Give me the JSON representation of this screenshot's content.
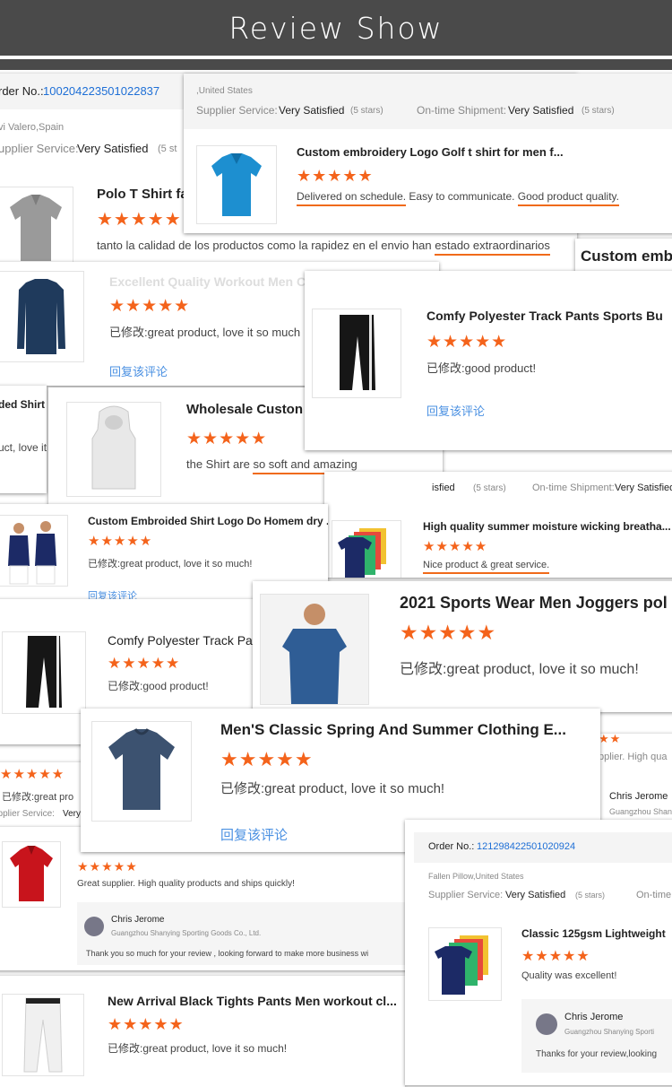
{
  "banner": {
    "title": "Review Show"
  },
  "card1": {
    "order_label": "rder No.:",
    "order_no": "100204223501022837",
    "location": "vi Valero,Spain",
    "supplier_label": "upplier Service:",
    "supplier_value": "Very Satisfied",
    "stars_note": "(5 st",
    "product_title": "Polo T Shirt fa",
    "stars": "★★★★★",
    "comment_prefix": "tanto la calidad de los productos como la rapidez en el envio han ",
    "comment_highlight": "estado extraordinarios"
  },
  "card2": {
    "location": ",United States",
    "supplier_label": "Supplier Service:",
    "supplier_value": "Very Satisfied",
    "supplier_stars": "(5 stars)",
    "shipment_label": "On-time Shipment:",
    "shipment_value": "Very Satisfied",
    "shipment_stars": "(5 stars)",
    "product_title": "Custom embroidery Logo Golf t shirt for men f...",
    "stars": "★★★★★",
    "comment_part1": "Delivered on schedule.",
    "comment_part2": " Easy to communicate. ",
    "comment_part3": "Good product quality."
  },
  "card3": {
    "faded_title": "Excellent Quality Workout Men C",
    "stars": "★★★★★",
    "comment": "已修改:great product, love it so much",
    "reply": "回复该评论"
  },
  "card_emb": {
    "title": "Custom emb"
  },
  "card4": {
    "product_title": "Comfy Polyester Track Pants Sports Bu",
    "stars": "★★★★★",
    "comment": "已修改:good product!",
    "reply": "回复该评论"
  },
  "card5": {
    "left_fragment1": "ded Shirt",
    "left_fragment2": "uct, love it",
    "product_title": "Wholesale Custon",
    "stars": "★★★★★",
    "comment_prefix": "the Shirt are ",
    "comment_highlight": "so soft and amazing"
  },
  "card6": {
    "fragment": "isfied",
    "stars_note": "(5 stars)",
    "shipment_label": "On-time Shipment:",
    "shipment_value": "Very Satisfied",
    "product_title": "High quality summer moisture wicking breatha...",
    "stars": "★★★★★",
    "comment": "Nice product & great service."
  },
  "card7": {
    "product_title": "Custom Embroided Shirt Logo Do Homem dry ...",
    "stars": "★★★★★",
    "comment": "已修改:great product, love it so much!",
    "reply": "回复该评论"
  },
  "card8": {
    "product_title": "Comfy Polyester Track Pa",
    "stars": "★★★★★",
    "comment": "已修改:good product!"
  },
  "card9": {
    "product_title": "2021 Sports Wear Men Joggers pol",
    "stars": "★★★★★",
    "comment": "已修改:great product, love it so much!"
  },
  "card10": {
    "product_title": "Men'S Classic Spring And Summer Clothing E...",
    "stars": "★★★★★",
    "comment": "已修改:great product, love it so much!",
    "reply": "回复该评论"
  },
  "card11": {
    "stars_top": "★★★★★",
    "comment_fragment": "已修改:great pro",
    "supplier_fragment": "upplier Service:",
    "supplier_value_fragment": "Very"
  },
  "card12": {
    "stars": "★★★★★",
    "comment": "Great supplier. High quality products and ships quickly!",
    "reply_name": "Chris Jerome",
    "reply_company": "Guangzhou Shanying Sporting Goods Co., Ltd.",
    "reply_text": "Thank you so  much for your review , looking forward to make more business wi"
  },
  "card_side": {
    "stars": "★★",
    "fragment": "pplier. High qua",
    "name": "Chris Jerome",
    "company": "Guangzhou Shan"
  },
  "card13": {
    "product_title": "New Arrival Black Tights Pants Men workout cl...",
    "stars": "★★★★★",
    "comment": "已修改:great product, love it so much!"
  },
  "card14": {
    "order_label": "Order No.:",
    "order_no": "121298422501020924",
    "location": "Fallen Pillow,United States",
    "supplier_label": "Supplier Service:",
    "supplier_value": "Very Satisfied",
    "supplier_stars": "(5 stars)",
    "shipment_fragment": "On-time",
    "product_title": "Classic 125gsm Lightweight",
    "stars": "★★★★★",
    "comment": "Quality was excellent!",
    "reply_name": "Chris Jerome",
    "reply_company": "Guangzhou Shanying Sporti",
    "reply_text": "Thanks for your review,looking"
  },
  "colors": {
    "accent": "#f4631b",
    "link": "#4a90e2",
    "order_no": "#1e6fd6",
    "banner": "#4a4a4a"
  },
  "icons": [
    "polo-shirt-icon",
    "long-sleeve-shirt-icon",
    "track-pants-icon",
    "hooded-vest-icon",
    "tshirt-stack-icon",
    "tights-icon",
    "avatar-icon"
  ]
}
